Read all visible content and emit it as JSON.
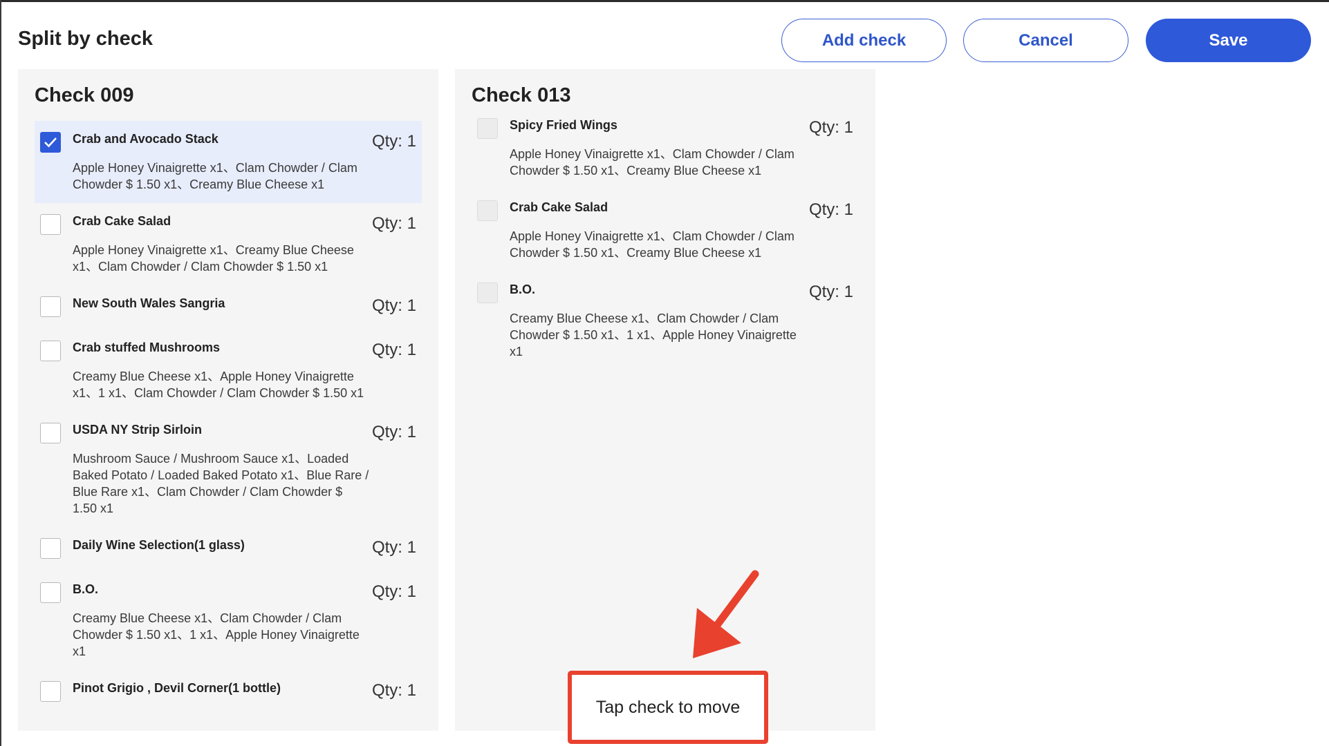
{
  "dialog": {
    "title": "Split by check",
    "add_check_label": "Add check",
    "cancel_label": "Cancel",
    "save_label": "Save"
  },
  "checks": [
    {
      "title": "Check 009",
      "items": [
        {
          "name": "Crab and Avocado Stack",
          "qty": "Qty: 1",
          "mods": "Apple Honey Vinaigrette x1、Clam Chowder / Clam Chowder $ 1.50 x1、Creamy Blue Cheese x1",
          "checked": true
        },
        {
          "name": "Crab Cake Salad",
          "qty": "Qty: 1",
          "mods": "Apple Honey Vinaigrette x1、Creamy Blue Cheese x1、Clam Chowder / Clam Chowder $ 1.50 x1",
          "checked": false
        },
        {
          "name": "New South Wales Sangria",
          "qty": "Qty: 1",
          "mods": "",
          "checked": false
        },
        {
          "name": "Crab stuffed Mushrooms",
          "qty": "Qty: 1",
          "mods": "Creamy Blue Cheese x1、Apple Honey Vinaigrette x1、1 x1、Clam Chowder / Clam Chowder $ 1.50 x1",
          "checked": false
        },
        {
          "name": "USDA NY Strip Sirloin",
          "qty": "Qty: 1",
          "mods": "Mushroom Sauce / Mushroom Sauce x1、Loaded Baked Potato / Loaded Baked Potato x1、Blue Rare / Blue Rare x1、Clam Chowder / Clam Chowder $ 1.50 x1",
          "checked": false
        },
        {
          "name": "Daily Wine Selection(1 glass)",
          "qty": "Qty: 1",
          "mods": "",
          "checked": false
        },
        {
          "name": "B.O.",
          "qty": "Qty: 1",
          "mods": "Creamy Blue Cheese x1、Clam Chowder / Clam Chowder $ 1.50 x1、1 x1、Apple Honey Vinaigrette x1",
          "checked": false
        },
        {
          "name": "Pinot Grigio , Devil Corner(1 bottle)",
          "qty": "Qty: 1",
          "mods": "",
          "checked": false
        }
      ]
    },
    {
      "title": "Check 013",
      "items": [
        {
          "name": "Spicy Fried Wings",
          "qty": "Qty: 1",
          "mods": "Apple Honey Vinaigrette x1、Clam Chowder / Clam Chowder $ 1.50 x1、Creamy Blue Cheese x1",
          "checked": false
        },
        {
          "name": "Crab Cake Salad",
          "qty": "Qty: 1",
          "mods": "Apple Honey Vinaigrette x1、Clam Chowder / Clam Chowder $ 1.50 x1、Creamy Blue Cheese x1",
          "checked": false
        },
        {
          "name": "B.O.",
          "qty": "Qty: 1",
          "mods": "Creamy Blue Cheese x1、Clam Chowder / Clam Chowder $ 1.50 x1、1 x1、Apple Honey Vinaigrette x1",
          "checked": false
        }
      ]
    }
  ],
  "hint": {
    "text": "Tap check to move",
    "arrow_icon": "red-arrow-icon",
    "color": "#e8412e"
  },
  "colors": {
    "accent": "#2e59d9",
    "panel_bg": "#f5f5f5",
    "selected_bg": "#e8edfb"
  }
}
